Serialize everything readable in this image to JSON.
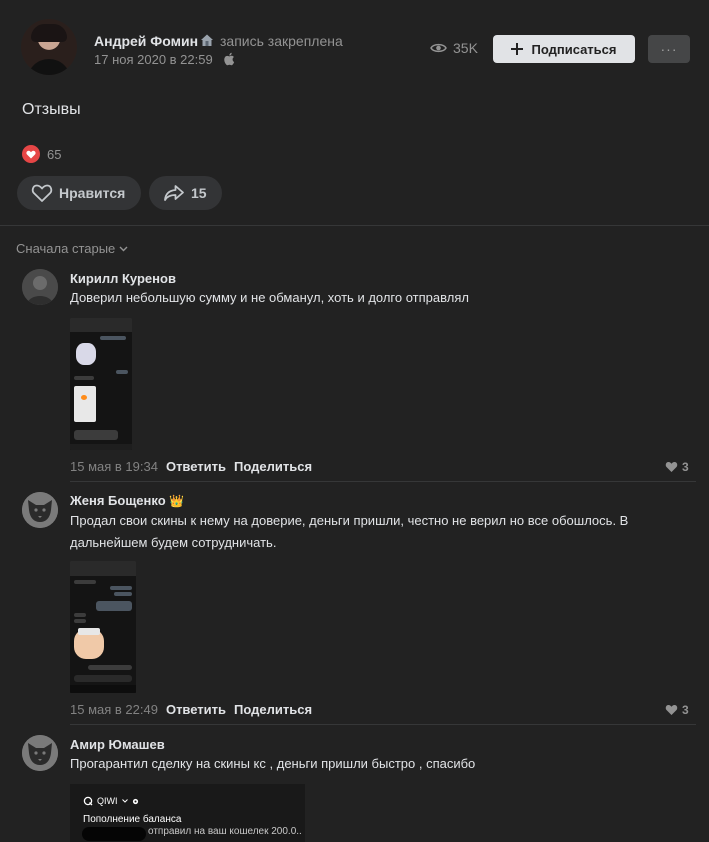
{
  "post": {
    "author": "Андрей Фомин",
    "pinned_label": "запись закреплена",
    "date": "17 ноя 2020 в 22:59",
    "views": "35K",
    "subscribe_label": "Подписаться",
    "more_label": "···",
    "text": "Отзывы",
    "reactions_count": "65",
    "like_label": "Нравится",
    "share_count": "15"
  },
  "sort_label": "Сначала старые",
  "comments": [
    {
      "name": "Кирилл Куренов",
      "text": "Доверил небольшую сумму и не обманул, хоть и долго отправлял",
      "date": "15 мая в 19:34",
      "reply_label": "Ответить",
      "share_label": "Поделиться",
      "likes": "3"
    },
    {
      "name": "Женя Бощенко",
      "badge": "👑",
      "text": "Продал свои скины к нему на доверие, деньги пришли, честно не верил но все обошлось. В дальнейшем будем сотрудничать.",
      "date": "15 мая в 22:49",
      "reply_label": "Ответить",
      "share_label": "Поделиться",
      "likes": "3"
    },
    {
      "name": "Амир Юмашев",
      "text": "Прогарантил сделку на скины кс , деньги пришли быстро , спасибо",
      "attachment": {
        "brand": "QIWI",
        "title": "Пополнение баланса",
        "subtitle": "отправил на ваш кошелек 200.0.."
      }
    }
  ],
  "colors": {
    "background": "#222222",
    "text": "#e1e3e6",
    "muted": "#939393",
    "button_bg": "#333436",
    "subscribe_bg": "#e1e3e6",
    "heart": "#e64646"
  }
}
